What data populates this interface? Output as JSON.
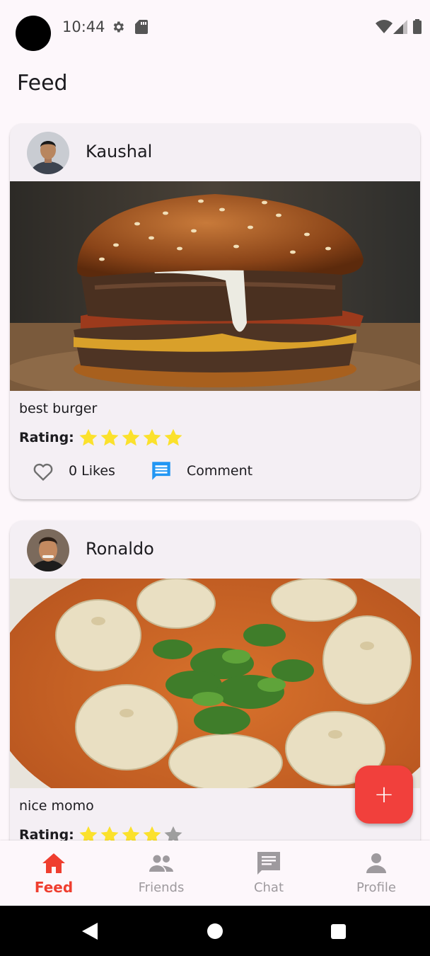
{
  "status_bar": {
    "time": "10:44"
  },
  "app_bar": {
    "title": "Feed"
  },
  "posts": [
    {
      "author": "Kaushal",
      "caption": "best burger",
      "rating_label": "Rating:",
      "rating": 5,
      "rating_max": 5,
      "likes_text": "0 Likes",
      "comment_label": "Comment",
      "photo_icon": "burger-photo"
    },
    {
      "author": "Ronaldo",
      "caption": "nice momo",
      "rating_label": "Rating:",
      "rating": 4,
      "rating_max": 5,
      "photo_icon": "momo-photo"
    }
  ],
  "fab": {
    "icon": "plus-icon",
    "label": "+"
  },
  "bottom_nav": [
    {
      "label": "Feed",
      "icon": "home-icon",
      "active": true
    },
    {
      "label": "Friends",
      "icon": "people-icon",
      "active": false
    },
    {
      "label": "Chat",
      "icon": "chat-icon",
      "active": false
    },
    {
      "label": "Profile",
      "icon": "person-icon",
      "active": false
    }
  ],
  "colors": {
    "accent": "#ef3e2f",
    "star": "#fbe12c",
    "star_empty": "#9e9e9e",
    "comment_icon": "#2196f3",
    "background": "#fdf7fb",
    "card": "#f4eff4"
  }
}
